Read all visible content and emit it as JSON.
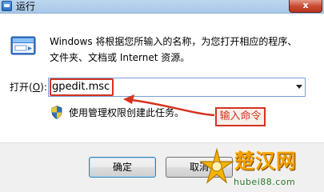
{
  "window": {
    "title": "运行",
    "close_glyph": "x"
  },
  "description": {
    "line1": "Windows 将根据您所输入的名称，为您打开相应的程序、",
    "line2": "文件夹、文档或 Internet 资源。"
  },
  "open_field": {
    "label_prefix": "打开(",
    "label_accel": "O",
    "label_suffix": "):",
    "value": "gpedit.msc"
  },
  "admin_note": "使用管理权限创建此任务。",
  "annotation": {
    "text": "输入命令",
    "color": "#d6321f"
  },
  "buttons": {
    "ok": "确定",
    "cancel": "取消"
  },
  "watermark": {
    "brand": "楚汉网",
    "url": "hubei88.com"
  },
  "icons": {
    "title": "run-app-icon",
    "dialog": "run-dialog-icon",
    "admin": "uac-shield-icon",
    "dropdown": "chevron-down-icon"
  }
}
